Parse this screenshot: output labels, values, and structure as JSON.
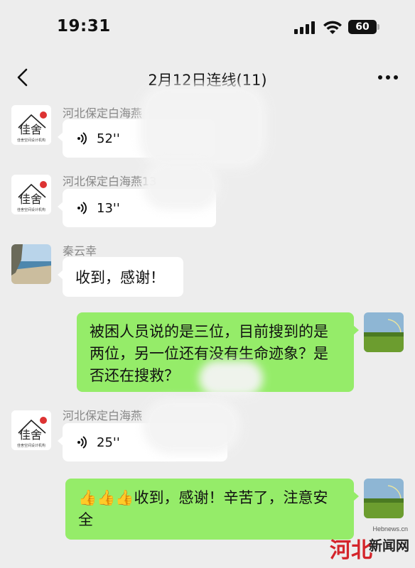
{
  "status_bar": {
    "time": "19:31",
    "battery": "60"
  },
  "header": {
    "title": "2月12日连线(11)"
  },
  "messages": [
    {
      "sender": "河北保定白海燕",
      "type": "voice",
      "duration": "52''",
      "direction": "in"
    },
    {
      "sender": "河北保定白海燕13",
      "type": "voice",
      "duration": "13''",
      "direction": "in"
    },
    {
      "sender": "秦云幸",
      "type": "text",
      "text": "收到，感谢！",
      "direction": "in"
    },
    {
      "type": "text",
      "text": "被困人员说的是三位，目前搜到的是两位，另一位还有没有生命迹象？是否还在搜救？",
      "direction": "out"
    },
    {
      "sender": "河北保定白海燕",
      "type": "voice",
      "duration": "25''",
      "direction": "in"
    },
    {
      "type": "text",
      "emoji": "👍👍👍",
      "text": "收到，感谢！辛苦了，注意安全",
      "direction": "out"
    }
  ],
  "avatar_logo_text": "佳舍空间设计机构",
  "watermark": {
    "en": "Hebnews.cn",
    "cn": "新闻网",
    "mark": "河北"
  },
  "colors": {
    "background": "#ededed",
    "incoming_bubble": "#ffffff",
    "outgoing_bubble": "#95ec69"
  }
}
